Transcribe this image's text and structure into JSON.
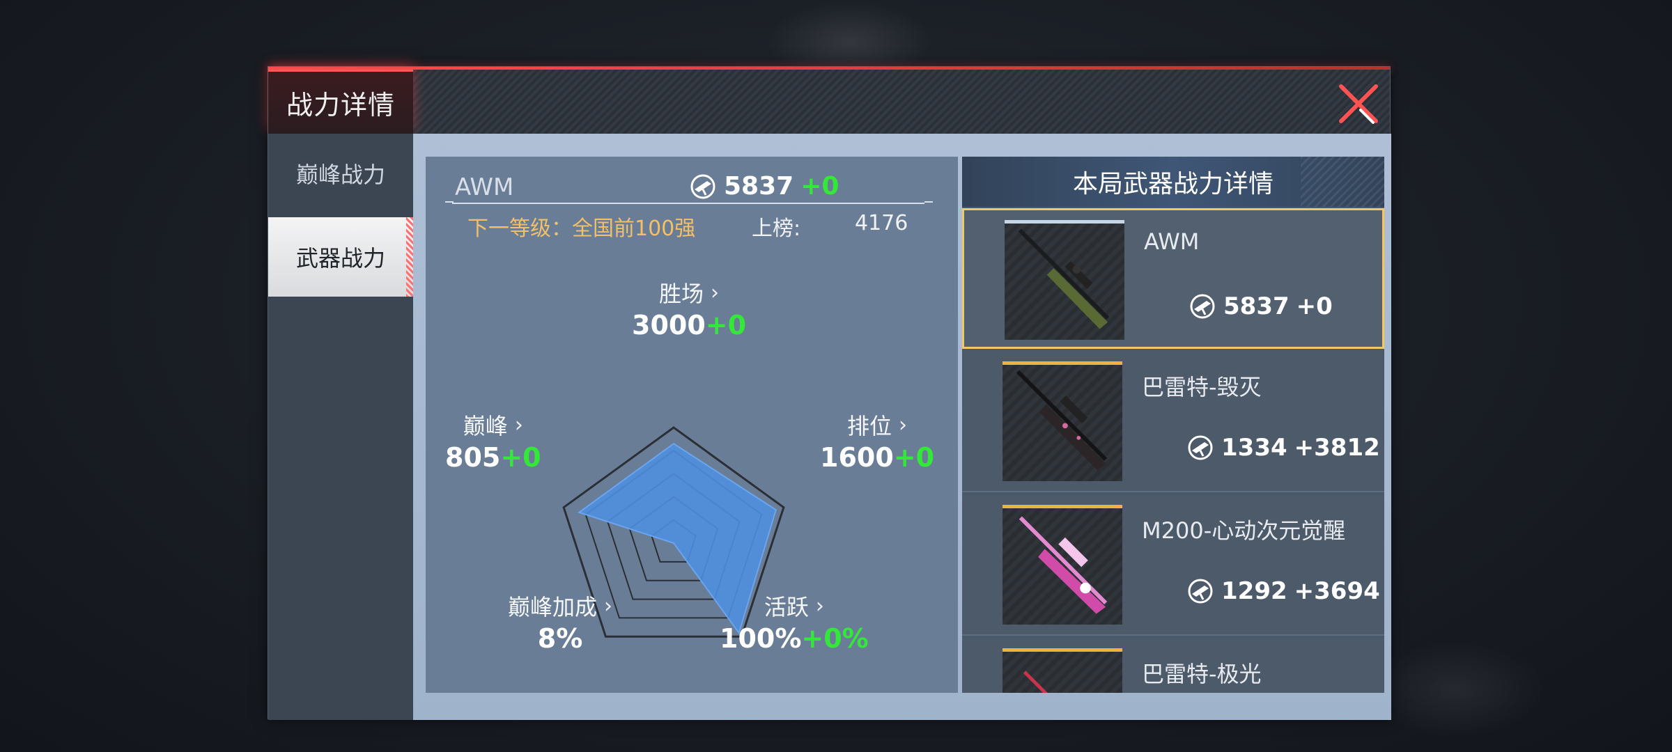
{
  "dialog": {
    "title": "战力详情",
    "close_icon": "close-x-icon"
  },
  "sidebar": {
    "items": [
      {
        "label": "巅峰战力",
        "active": false
      },
      {
        "label": "武器战力",
        "active": true
      }
    ]
  },
  "weapon": {
    "name": "AWM",
    "power": "5837",
    "power_delta": "+0",
    "next_level_label": "下一等级：全国前",
    "next_level_value": "100强",
    "rank_label": "上榜:",
    "rank_value": "4176"
  },
  "radar": {
    "stats": [
      {
        "key": "wins",
        "label": "胜场",
        "value": "3000",
        "delta": "+0",
        "score": 0.86
      },
      {
        "key": "rank",
        "label": "排位",
        "value": "1600",
        "delta": "+0",
        "score": 0.93
      },
      {
        "key": "active",
        "label": "活跃",
        "value": "100%",
        "delta": "+0%",
        "score": 0.96
      },
      {
        "key": "peak_bonus",
        "label": "巅峰加成",
        "value": "8%",
        "delta": "",
        "score": 0.0
      },
      {
        "key": "peak",
        "label": "巅峰",
        "value": "805",
        "delta": "+0",
        "score": 0.86
      }
    ],
    "fill_color": "#4f8fe0",
    "grid_color": "#2a2f36"
  },
  "weapon_list": {
    "title": "本局武器战力详情",
    "items": [
      {
        "name": "AWM",
        "power": "5837",
        "delta": "+0",
        "selected": true
      },
      {
        "name": "巴雷特-毁灭",
        "power": "1334",
        "delta": "+3812",
        "selected": false
      },
      {
        "name": "M200-心动次元觉醒",
        "power": "1292",
        "delta": "+3694",
        "selected": false
      },
      {
        "name": "巴雷特-极光",
        "power": "",
        "delta": "",
        "selected": false
      }
    ]
  },
  "colors": {
    "accent_red": "#ff4d4d",
    "delta_green": "#34e83a",
    "gold": "#f1c069",
    "selected_border": "#f2c766"
  }
}
